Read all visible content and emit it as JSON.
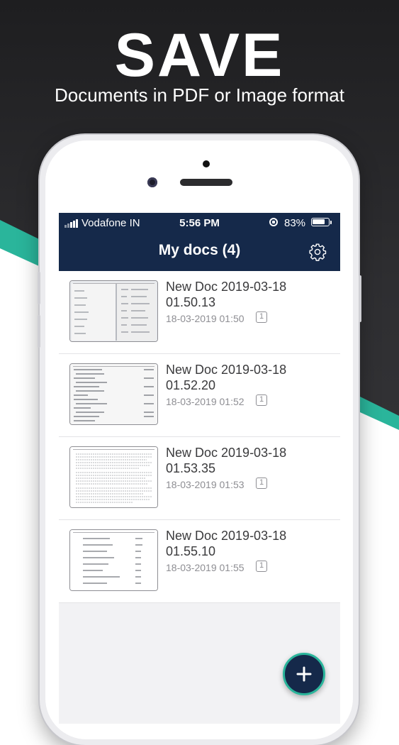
{
  "promo": {
    "headline": "SAVE",
    "subhead": "Documents in PDF or Image format"
  },
  "status_bar": {
    "carrier": "Vodafone IN",
    "time": "5:56 PM",
    "battery": "83%",
    "battery_level": 0.83
  },
  "header": {
    "title": "My docs (4)",
    "settings_icon": "gear-icon"
  },
  "documents": [
    {
      "name": "New Doc 2019-03-18 01.50.13",
      "date": "18-03-2019 01:50",
      "pages": "1"
    },
    {
      "name": "New Doc 2019-03-18 01.52.20",
      "date": "18-03-2019 01:52",
      "pages": "1"
    },
    {
      "name": "New Doc 2019-03-18 01.53.35",
      "date": "18-03-2019 01:53",
      "pages": "1"
    },
    {
      "name": "New Doc 2019-03-18 01.55.10",
      "date": "18-03-2019 01:55",
      "pages": "1"
    }
  ],
  "fab": {
    "icon": "plus-icon"
  },
  "colors": {
    "navbar": "#15294a",
    "accent": "#2ab59b",
    "background_dark": "#2e2e31"
  }
}
